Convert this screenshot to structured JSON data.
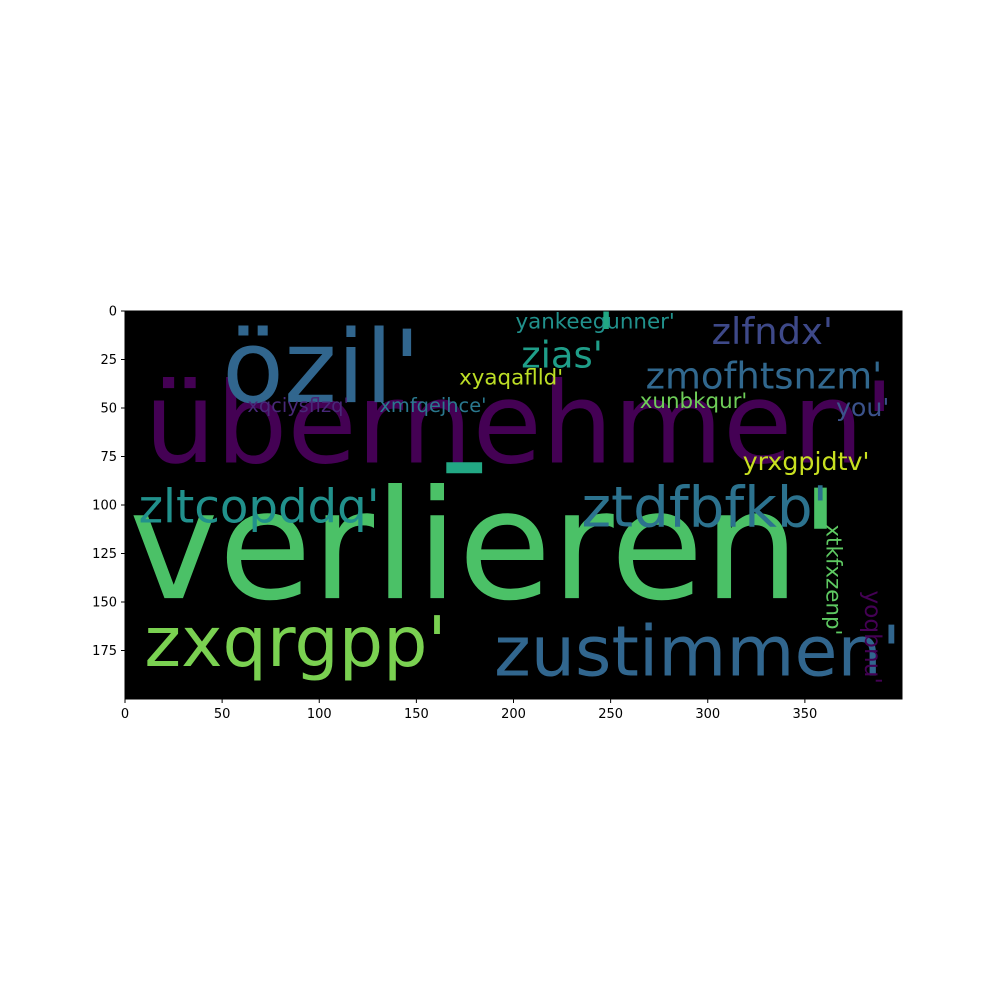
{
  "chart_data": {
    "type": "wordcloud-image",
    "background": "#000000",
    "xlim": [
      0,
      400
    ],
    "ylim": [
      200,
      0
    ],
    "x_ticks": [
      0,
      50,
      100,
      150,
      200,
      250,
      300,
      350
    ],
    "y_ticks": [
      0,
      25,
      50,
      75,
      100,
      125,
      150,
      175
    ],
    "words": [
      {
        "text": "verlieren'",
        "x": 2,
        "y": 148,
        "size": 78,
        "color": "#4bc167",
        "rotate": 0
      },
      {
        "text": "übernehmen'",
        "x": 10,
        "y": 78,
        "size": 58,
        "color": "#440154",
        "rotate": 0
      },
      {
        "text": "özil'",
        "x": 50,
        "y": 47,
        "size": 52,
        "color": "#31668e",
        "rotate": 0
      },
      {
        "text": "zxqrgpp'",
        "x": 10,
        "y": 183,
        "size": 36,
        "color": "#7ad151",
        "rotate": 0
      },
      {
        "text": "zustimmen'",
        "x": 190,
        "y": 188,
        "size": 36,
        "color": "#31668e",
        "rotate": 0
      },
      {
        "text": "ztdfbfkb'",
        "x": 235,
        "y": 111,
        "size": 29,
        "color": "#2c728e",
        "rotate": 0
      },
      {
        "text": "zltcopddq'",
        "x": 7,
        "y": 109,
        "size": 24,
        "color": "#21918c",
        "rotate": 0
      },
      {
        "text": "zlfndx'",
        "x": 302,
        "y": 17,
        "size": 19,
        "color": "#3e4989",
        "rotate": 0
      },
      {
        "text": "zmofhtsnzm'",
        "x": 268,
        "y": 40,
        "size": 19,
        "color": "#31688e",
        "rotate": 0
      },
      {
        "text": "zias'",
        "x": 204,
        "y": 29,
        "size": 19,
        "color": "#1f9e89",
        "rotate": 0
      },
      {
        "text": "yankeegunner'",
        "x": 201,
        "y": 9,
        "size": 11,
        "color": "#21918c",
        "rotate": 0
      },
      {
        "text": "xyaqaflld'",
        "x": 172,
        "y": 38,
        "size": 11,
        "color": "#bddf26",
        "rotate": 0
      },
      {
        "text": "xunbkqur'",
        "x": 265,
        "y": 50,
        "size": 11,
        "color": "#6ece58",
        "rotate": 0
      },
      {
        "text": "you'",
        "x": 366,
        "y": 54,
        "size": 13,
        "color": "#3b528b",
        "rotate": 0
      },
      {
        "text": "xqciysflzq'",
        "x": 63,
        "y": 52,
        "size": 10,
        "color": "#482878",
        "rotate": 0
      },
      {
        "text": "xmfqejhce'",
        "x": 131,
        "y": 52,
        "size": 10,
        "color": "#2a788e",
        "rotate": 0
      },
      {
        "text": "yrxgpjdtv'",
        "x": 318,
        "y": 82,
        "size": 13,
        "color": "#c8e020",
        "rotate": 0
      },
      {
        "text": "xtkfxzenp'",
        "x": 361,
        "y": 110,
        "size": 11,
        "color": "#5ec962",
        "rotate": 90
      },
      {
        "text": "yoqbnu'",
        "x": 381,
        "y": 144,
        "size": 12,
        "color": "#440154",
        "rotate": 90
      },
      {
        "text": "'",
        "x": 243,
        "y": 25,
        "size": 34,
        "color": "#22a884",
        "rotate": 0
      },
      {
        "text": "-",
        "x": 162,
        "y": 100,
        "size": 70,
        "color": "#22a884",
        "rotate": 0
      }
    ]
  }
}
